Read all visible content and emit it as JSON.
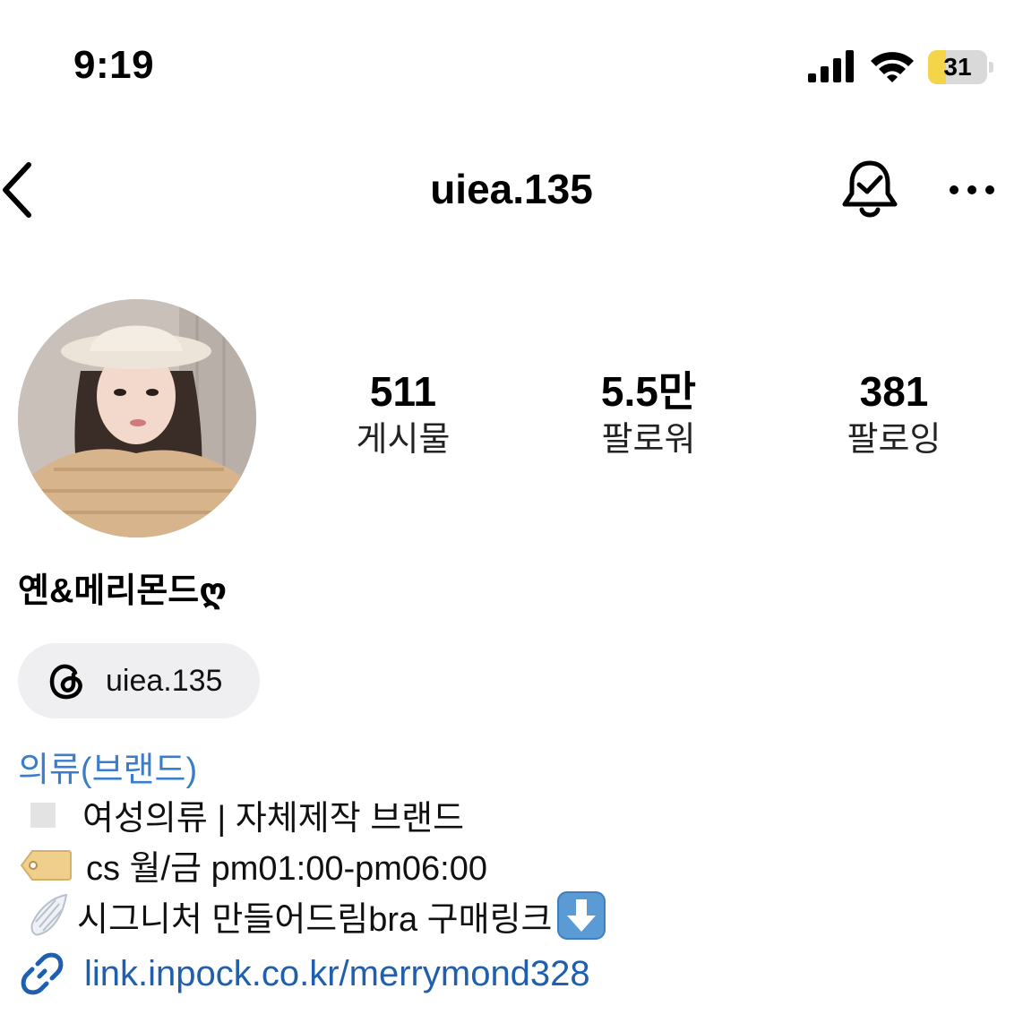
{
  "status_bar": {
    "time": "9:19",
    "battery_level": "31",
    "battery_fraction": 0.31
  },
  "header": {
    "username": "uiea.135",
    "icons": [
      "back-chevron-icon",
      "notification-bell-check-icon",
      "more-options-icon"
    ]
  },
  "profile": {
    "stats": [
      {
        "value": "511",
        "label": "게시물"
      },
      {
        "value": "5.5만",
        "label": "팔로워"
      },
      {
        "value": "381",
        "label": "팔로잉"
      }
    ],
    "display_name": "옌&메리몬드ღ",
    "threads_handle": "uiea.135",
    "category": "의류(브랜드)",
    "bio": [
      "여성의류 | 자체제작 브랜드",
      "cs 월/금 pm01:00-pm06:00",
      "시그니처 만들어드림bra 구매링크"
    ],
    "link": "link.inpock.co.kr/merrymond328"
  },
  "colors": {
    "link_blue": "#1f5fae",
    "category_blue": "#3a7dc9",
    "battery_yellow": "#f4d54a",
    "chip_bg": "#efeff1"
  }
}
